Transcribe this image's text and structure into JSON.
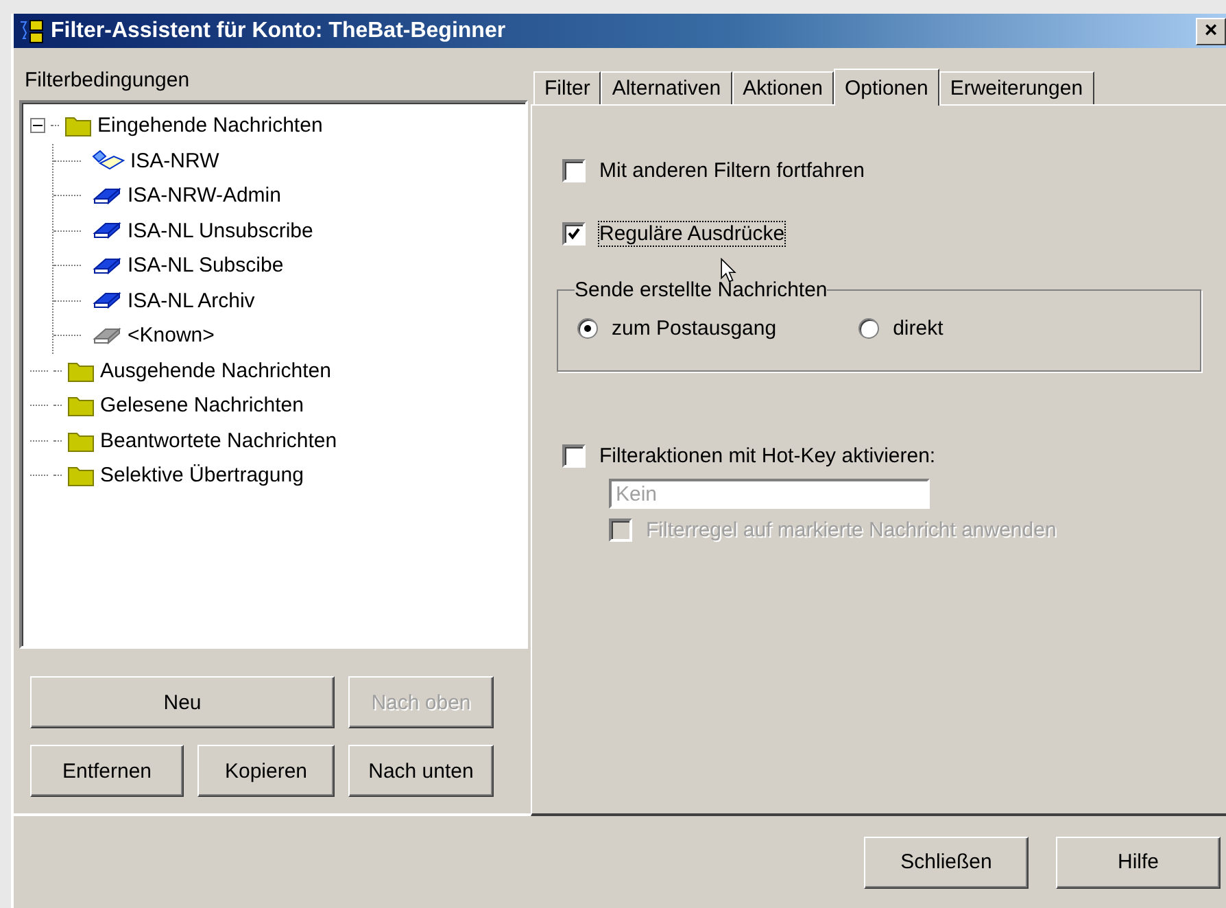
{
  "window": {
    "title": "Filter-Assistent für Konto: TheBat-Beginner",
    "close": "×"
  },
  "left": {
    "label": "Filterbedingungen",
    "tree": [
      {
        "label": "Eingehende Nachrichten",
        "kind": "folder",
        "expanded": true,
        "children": [
          {
            "label": "ISA-NRW",
            "kind": "book-open"
          },
          {
            "label": "ISA-NRW-Admin",
            "kind": "book"
          },
          {
            "label": "ISA-NL Unsubscribe",
            "kind": "book"
          },
          {
            "label": "ISA-NL Subscibe",
            "kind": "book"
          },
          {
            "label": "ISA-NL Archiv",
            "kind": "book"
          },
          {
            "label": "<Known>",
            "kind": "book-grey"
          }
        ]
      },
      {
        "label": "Ausgehende Nachrichten",
        "kind": "folder"
      },
      {
        "label": "Gelesene Nachrichten",
        "kind": "folder"
      },
      {
        "label": "Beantwortete Nachrichten",
        "kind": "folder"
      },
      {
        "label": "Selektive Übertragung",
        "kind": "folder"
      }
    ],
    "buttons": [
      {
        "label": "Neu",
        "disabled": false
      },
      {
        "label": "Nach oben",
        "disabled": true
      },
      {
        "label": "Entfernen",
        "disabled": false
      },
      {
        "label": "Kopieren",
        "disabled": false
      },
      {
        "label": "Nach unten",
        "disabled": false
      }
    ]
  },
  "tabs": [
    {
      "label": "Filter",
      "selected": false
    },
    {
      "label": "Alternativen",
      "selected": false
    },
    {
      "label": "Aktionen",
      "selected": false
    },
    {
      "label": "Optionen",
      "selected": true
    },
    {
      "label": "Erweiterungen",
      "selected": false
    }
  ],
  "options": {
    "continue": {
      "label": "Mit anderen Filtern fortfahren",
      "checked": false
    },
    "regex": {
      "label": "Reguläre Ausdrücke",
      "checked": true
    },
    "send_group": {
      "label": "Sende erstellte Nachrichten",
      "radios": [
        {
          "label": "zum Postausgang",
          "selected": true
        },
        {
          "label": "direkt",
          "selected": false
        }
      ]
    },
    "hotkey": {
      "label": "Filteraktionen mit Hot-Key aktivieren:",
      "checked": false
    },
    "hotkey_field": {
      "value": "Kein",
      "disabled": true
    },
    "apply": {
      "label": "Filterregel auf markierte Nachricht anwenden",
      "checked": false,
      "disabled": true
    }
  },
  "footer": {
    "buttons": [
      "Schließen",
      "Hilfe"
    ]
  }
}
